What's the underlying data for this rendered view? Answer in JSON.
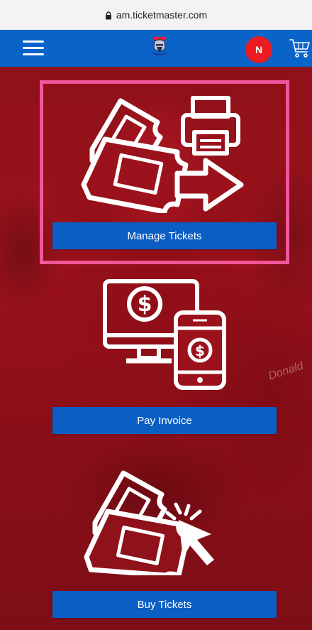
{
  "browser": {
    "url": "am.ticketmaster.com",
    "lock_icon": "lock-icon"
  },
  "header": {
    "menu_icon": "hamburger-menu-icon",
    "logo_icon": "knights-logo-icon",
    "avatar_initial": "N",
    "cart_icon": "shopping-cart-icon",
    "colors": {
      "bar": "#0a63c9",
      "avatar": "#ea1b21"
    }
  },
  "tiles": [
    {
      "icon": "tickets-printer-arrow-icon",
      "label": "Manage Tickets",
      "highlighted": true
    },
    {
      "icon": "computer-phone-dollar-icon",
      "label": "Pay Invoice",
      "highlighted": false
    },
    {
      "icon": "tickets-cursor-icon",
      "label": "Buy Tickets",
      "highlighted": false
    }
  ],
  "background": {
    "watermark_text": "Donald",
    "colors": {
      "hero": "#8f1119",
      "button": "#0b5ec3",
      "highlight": "#f2569b"
    }
  }
}
